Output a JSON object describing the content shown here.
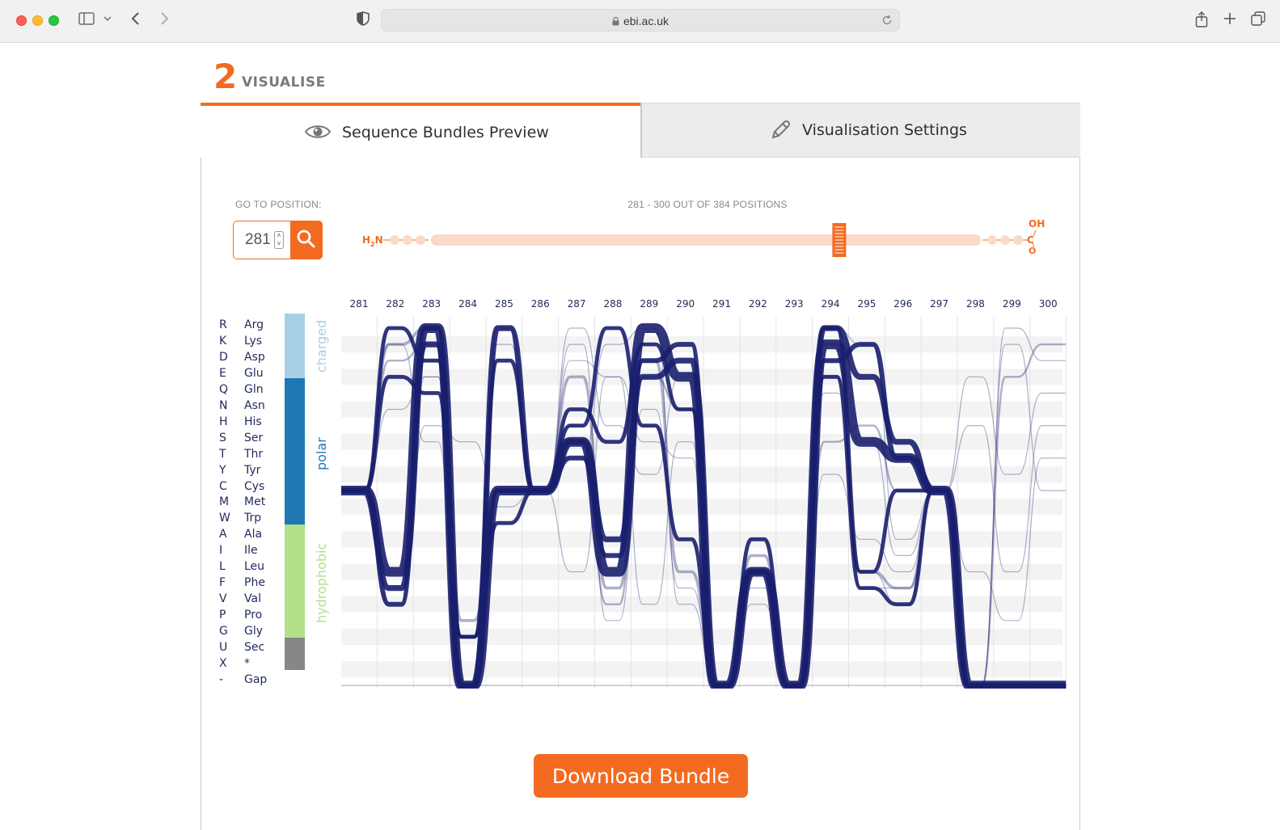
{
  "browser": {
    "url": "ebi.ac.uk",
    "icons": [
      "sidebar-icon",
      "chevron-down-icon",
      "back-icon",
      "forward-icon",
      "shield-icon",
      "lock-icon",
      "reload-icon",
      "share-icon",
      "new-tab-icon",
      "tabs-icon"
    ]
  },
  "step": {
    "number": "2",
    "label": "VISUALISE"
  },
  "tabs": [
    {
      "label": "Sequence Bundles Preview",
      "icon": "eye-icon",
      "active": true
    },
    {
      "label": "Visualisation Settings",
      "icon": "pencil-icon",
      "active": false
    }
  ],
  "goto": {
    "label": "GO TO POSITION:",
    "value": "281",
    "button_icon": "search-icon"
  },
  "range": {
    "label": "281 - 300 OUT OF 384 POSITIONS",
    "n_terminus": "H",
    "n_sub": "2",
    "n_suffix": "N",
    "c_terminus": "C",
    "c_oh": "OH",
    "c_o": "O",
    "window_start_fraction": 0.73
  },
  "legend": [
    {
      "letter": "R",
      "name": "Arg"
    },
    {
      "letter": "K",
      "name": "Lys"
    },
    {
      "letter": "D",
      "name": "Asp"
    },
    {
      "letter": "E",
      "name": "Glu"
    },
    {
      "letter": "Q",
      "name": "Gln"
    },
    {
      "letter": "N",
      "name": "Asn"
    },
    {
      "letter": "H",
      "name": "His"
    },
    {
      "letter": "S",
      "name": "Ser"
    },
    {
      "letter": "T",
      "name": "Thr"
    },
    {
      "letter": "Y",
      "name": "Tyr"
    },
    {
      "letter": "C",
      "name": "Cys"
    },
    {
      "letter": "M",
      "name": "Met"
    },
    {
      "letter": "W",
      "name": "Trp"
    },
    {
      "letter": "A",
      "name": "Ala"
    },
    {
      "letter": "I",
      "name": "Ile"
    },
    {
      "letter": "L",
      "name": "Leu"
    },
    {
      "letter": "F",
      "name": "Phe"
    },
    {
      "letter": "V",
      "name": "Val"
    },
    {
      "letter": "P",
      "name": "Pro"
    },
    {
      "letter": "G",
      "name": "Gly"
    },
    {
      "letter": "U",
      "name": "Sec"
    },
    {
      "letter": "X",
      "name": "*"
    },
    {
      "letter": "-",
      "name": "Gap"
    }
  ],
  "categories": [
    {
      "label": "charged",
      "color": "#a7d0e4",
      "rows": 4
    },
    {
      "label": "polar",
      "color": "#1f78b4",
      "rows": 9
    },
    {
      "label": "hydrophobic",
      "color": "#b2df8a",
      "rows": 7
    },
    {
      "label": "",
      "color": "#878787",
      "rows": 2
    }
  ],
  "chart_data": {
    "type": "sequence-bundle",
    "positions": [
      281,
      282,
      283,
      284,
      285,
      286,
      287,
      288,
      289,
      290,
      291,
      292,
      293,
      294,
      295,
      296,
      297,
      298,
      299,
      300
    ],
    "row_order": [
      "R",
      "K",
      "D",
      "E",
      "Q",
      "N",
      "H",
      "S",
      "T",
      "Y",
      "C",
      "M",
      "W",
      "A",
      "I",
      "L",
      "F",
      "V",
      "P",
      "G",
      "U",
      "X",
      "-"
    ],
    "colors": {
      "bundle": "#1a1f6e",
      "accent": "#f26b21",
      "track": "#fbd9c8"
    },
    "bundles": [
      {
        "weight": 10,
        "path": [
          "C",
          "L",
          "R",
          "-",
          "C",
          "C",
          "S",
          "L",
          "R",
          "E",
          "-",
          "L",
          "-",
          "K",
          "S",
          "T",
          "C",
          "-",
          "-",
          "-"
        ]
      },
      {
        "weight": 6,
        "path": [
          "C",
          "F",
          "K",
          "-",
          "R",
          "C",
          "S",
          "A",
          "E",
          "D",
          "-",
          "L",
          "-",
          "R",
          "E",
          "S",
          "C",
          "-",
          "-",
          "-"
        ]
      },
      {
        "weight": 5,
        "path": [
          "C",
          "V",
          "R",
          "-",
          "C",
          "C",
          "T",
          "I",
          "D",
          "K",
          "-",
          "L",
          "-",
          "D",
          "K",
          "T",
          "C",
          "-",
          "-",
          "-"
        ]
      },
      {
        "weight": 4,
        "path": [
          "C",
          "R",
          "D",
          "G",
          "D",
          "C",
          "N",
          "S",
          "K",
          "N",
          "-",
          "L",
          "-",
          "R",
          "L",
          "C",
          "C",
          "-",
          "-",
          "-"
        ]
      },
      {
        "weight": 4,
        "path": [
          "C",
          "E",
          "Q",
          "G",
          "W",
          "C",
          "H",
          "R",
          "H",
          "A",
          "-",
          "A",
          "-",
          "E",
          "F",
          "V",
          "C",
          "-",
          "-",
          "-"
        ]
      },
      {
        "weight": 3,
        "path": [
          "C",
          "K",
          "R",
          "P",
          "C",
          "C",
          "E",
          "F",
          "D",
          "L",
          "-",
          "I",
          "-",
          "K",
          "L",
          "F",
          "C",
          "-",
          "-",
          "-"
        ]
      },
      {
        "weight": 2,
        "path": [
          "C",
          "D",
          "K",
          "G",
          "R",
          "C",
          "S",
          "V",
          "E",
          "N",
          "-",
          "L",
          "-",
          "S",
          "H",
          "C",
          "C",
          "-",
          "E",
          "K"
        ]
      },
      {
        "weight": 1,
        "path": [
          "C",
          "N",
          "E",
          "-",
          "C",
          "C",
          "K",
          "P",
          "N",
          "F",
          "-",
          "L",
          "-",
          "Y",
          "A",
          "L",
          "C",
          "-",
          "R",
          "D"
        ]
      },
      {
        "weight": 1,
        "path": [
          "C",
          "F",
          "H",
          "S",
          "M",
          "C",
          "D",
          "E",
          "S",
          "T",
          "-",
          "V",
          "-",
          "Q",
          "S",
          "I",
          "C",
          "E",
          "Y",
          "Q"
        ]
      },
      {
        "weight": 1,
        "path": [
          "C",
          "L",
          "E",
          "-",
          "C",
          "C",
          "R",
          "H",
          "Y",
          "E",
          "-",
          "L",
          "-",
          "D",
          "F",
          "F",
          "C",
          "H",
          "L",
          "H"
        ]
      },
      {
        "weight": 1,
        "path": [
          "C",
          "V",
          "D",
          "-",
          "K",
          "C",
          "L",
          "E",
          "V",
          "S",
          "-",
          "F",
          "-",
          "R",
          "K",
          "A",
          "C",
          "-",
          "K",
          "C"
        ]
      },
      {
        "weight": 1,
        "path": [
          "C",
          "K",
          "S",
          "-",
          "C",
          "C",
          "T",
          "K",
          "R",
          "V",
          "-",
          "L",
          "-",
          "E",
          "L",
          "V",
          "C",
          "L",
          "P",
          "T"
        ]
      },
      {
        "weight": 1,
        "path": [
          "-",
          "-",
          "-",
          "-",
          "-",
          "-",
          "-",
          "-",
          "-",
          "-",
          "-",
          "-",
          "-",
          "-",
          "-",
          "-",
          "-",
          "-",
          "-",
          "-"
        ]
      }
    ]
  }
}
